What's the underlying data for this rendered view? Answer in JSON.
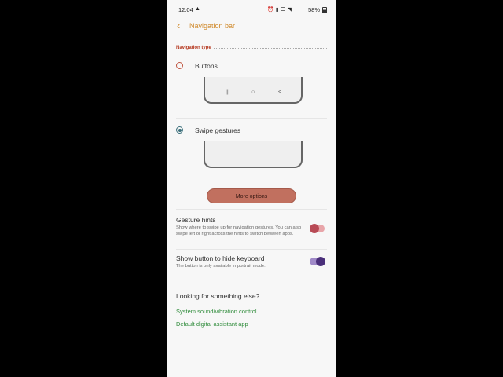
{
  "status_bar": {
    "time": "12:04",
    "icons": "⏰ ▮ ☰ ◥",
    "battery": "58%"
  },
  "header": {
    "title": "Navigation bar"
  },
  "navigation_type": {
    "section_label": "Navigation type",
    "options": [
      {
        "label": "Buttons",
        "selected": false
      },
      {
        "label": "Swipe gestures",
        "selected": true
      }
    ],
    "nav_keys": [
      "|||",
      "○",
      "<"
    ]
  },
  "more_options_label": "More options",
  "gesture_hints": {
    "title": "Gesture hints",
    "description": "Show where to swipe up for navigation gestures. You can also swipe left or right across the hints to switch between apps.",
    "enabled": true
  },
  "hide_keyboard": {
    "title": "Show button to hide keyboard",
    "description": "The button is only available in portrait mode.",
    "enabled": true
  },
  "looking_for": {
    "title": "Looking for something else?",
    "links": [
      "System sound/vibration control",
      "Default digital assistant app"
    ]
  },
  "colors": {
    "accent": "#d08a2c",
    "section_label": "#b5381f",
    "more_button": "#c1705f",
    "link": "#2e8b3a",
    "toggle_hints": "#b84a55",
    "toggle_keyboard": "#4a2f7a"
  }
}
